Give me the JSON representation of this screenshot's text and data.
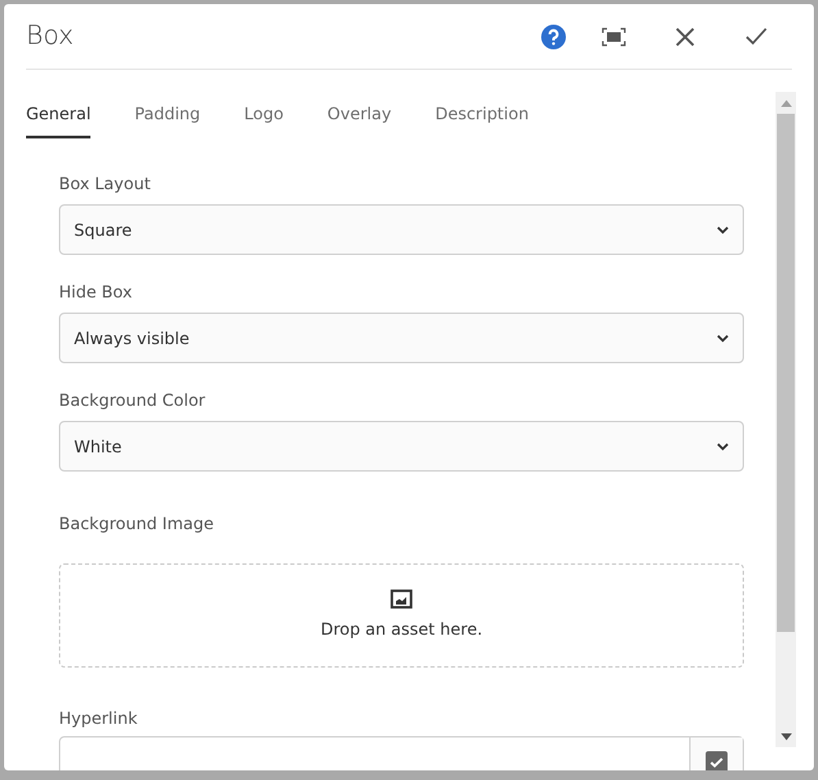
{
  "dialog": {
    "title": "Box",
    "header_buttons": [
      {
        "kind": "help"
      },
      {
        "kind": "fullscreen"
      },
      {
        "kind": "close"
      },
      {
        "kind": "done"
      }
    ],
    "tabs": [
      {
        "label": "General",
        "selected": true
      },
      {
        "label": "Padding",
        "selected": false
      },
      {
        "label": "Logo",
        "selected": false
      },
      {
        "label": "Overlay",
        "selected": false
      },
      {
        "label": "Description",
        "selected": false
      }
    ],
    "fields": [
      {
        "kind": "select",
        "label": "Box Layout",
        "value": "Square"
      },
      {
        "kind": "select",
        "label": "Hide Box",
        "value": "Always visible"
      },
      {
        "kind": "select",
        "label": "Background Color",
        "value": "White"
      },
      {
        "kind": "asset",
        "label": "Background Image",
        "hint": "Drop an asset here."
      },
      {
        "kind": "path",
        "label": "Hyperlink"
      }
    ]
  }
}
